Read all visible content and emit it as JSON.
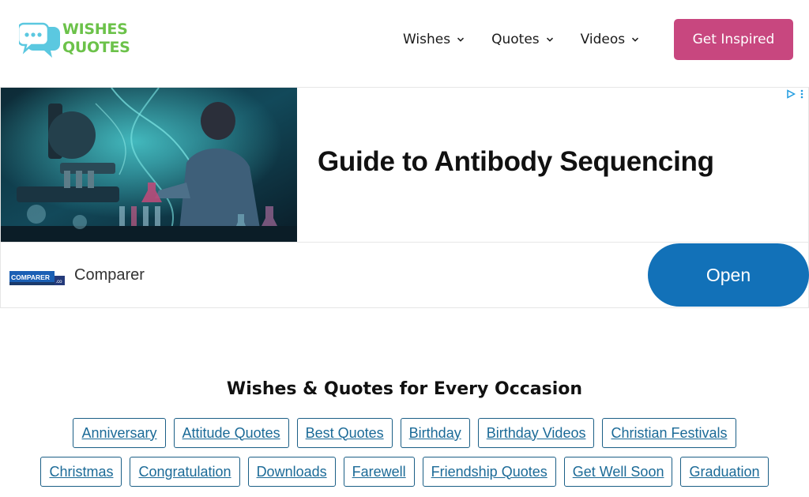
{
  "header": {
    "logo_line1": "WISHES",
    "logo_line2": "QUOTES",
    "nav": [
      {
        "label": "Wishes"
      },
      {
        "label": "Quotes"
      },
      {
        "label": "Videos"
      }
    ],
    "cta_label": "Get Inspired"
  },
  "ad": {
    "headline": "Guide to Antibody Sequencing",
    "brand_logo_text": "COMPARER",
    "brand_logo_suffix": ".co",
    "brand": "Comparer",
    "open_label": "Open"
  },
  "section": {
    "title": "Wishes & Quotes for Every Occasion",
    "tags_row1": [
      "Anniversary",
      "Attitude Quotes",
      "Best Quotes",
      "Birthday",
      "Birthday Videos",
      "Christian Festivals"
    ],
    "tags_row2": [
      "Christmas",
      "Congratulation",
      "Downloads",
      "Farewell",
      "Friendship Quotes",
      "Get Well Soon",
      "Graduation"
    ]
  },
  "colors": {
    "logo_green": "#6cc24a",
    "logo_icon_blue": "#5bc8e0",
    "cta_pink": "#c8477f",
    "ad_button_blue": "#1271b8",
    "tag_border": "#1b5f86",
    "tag_text": "#1b6a97"
  }
}
